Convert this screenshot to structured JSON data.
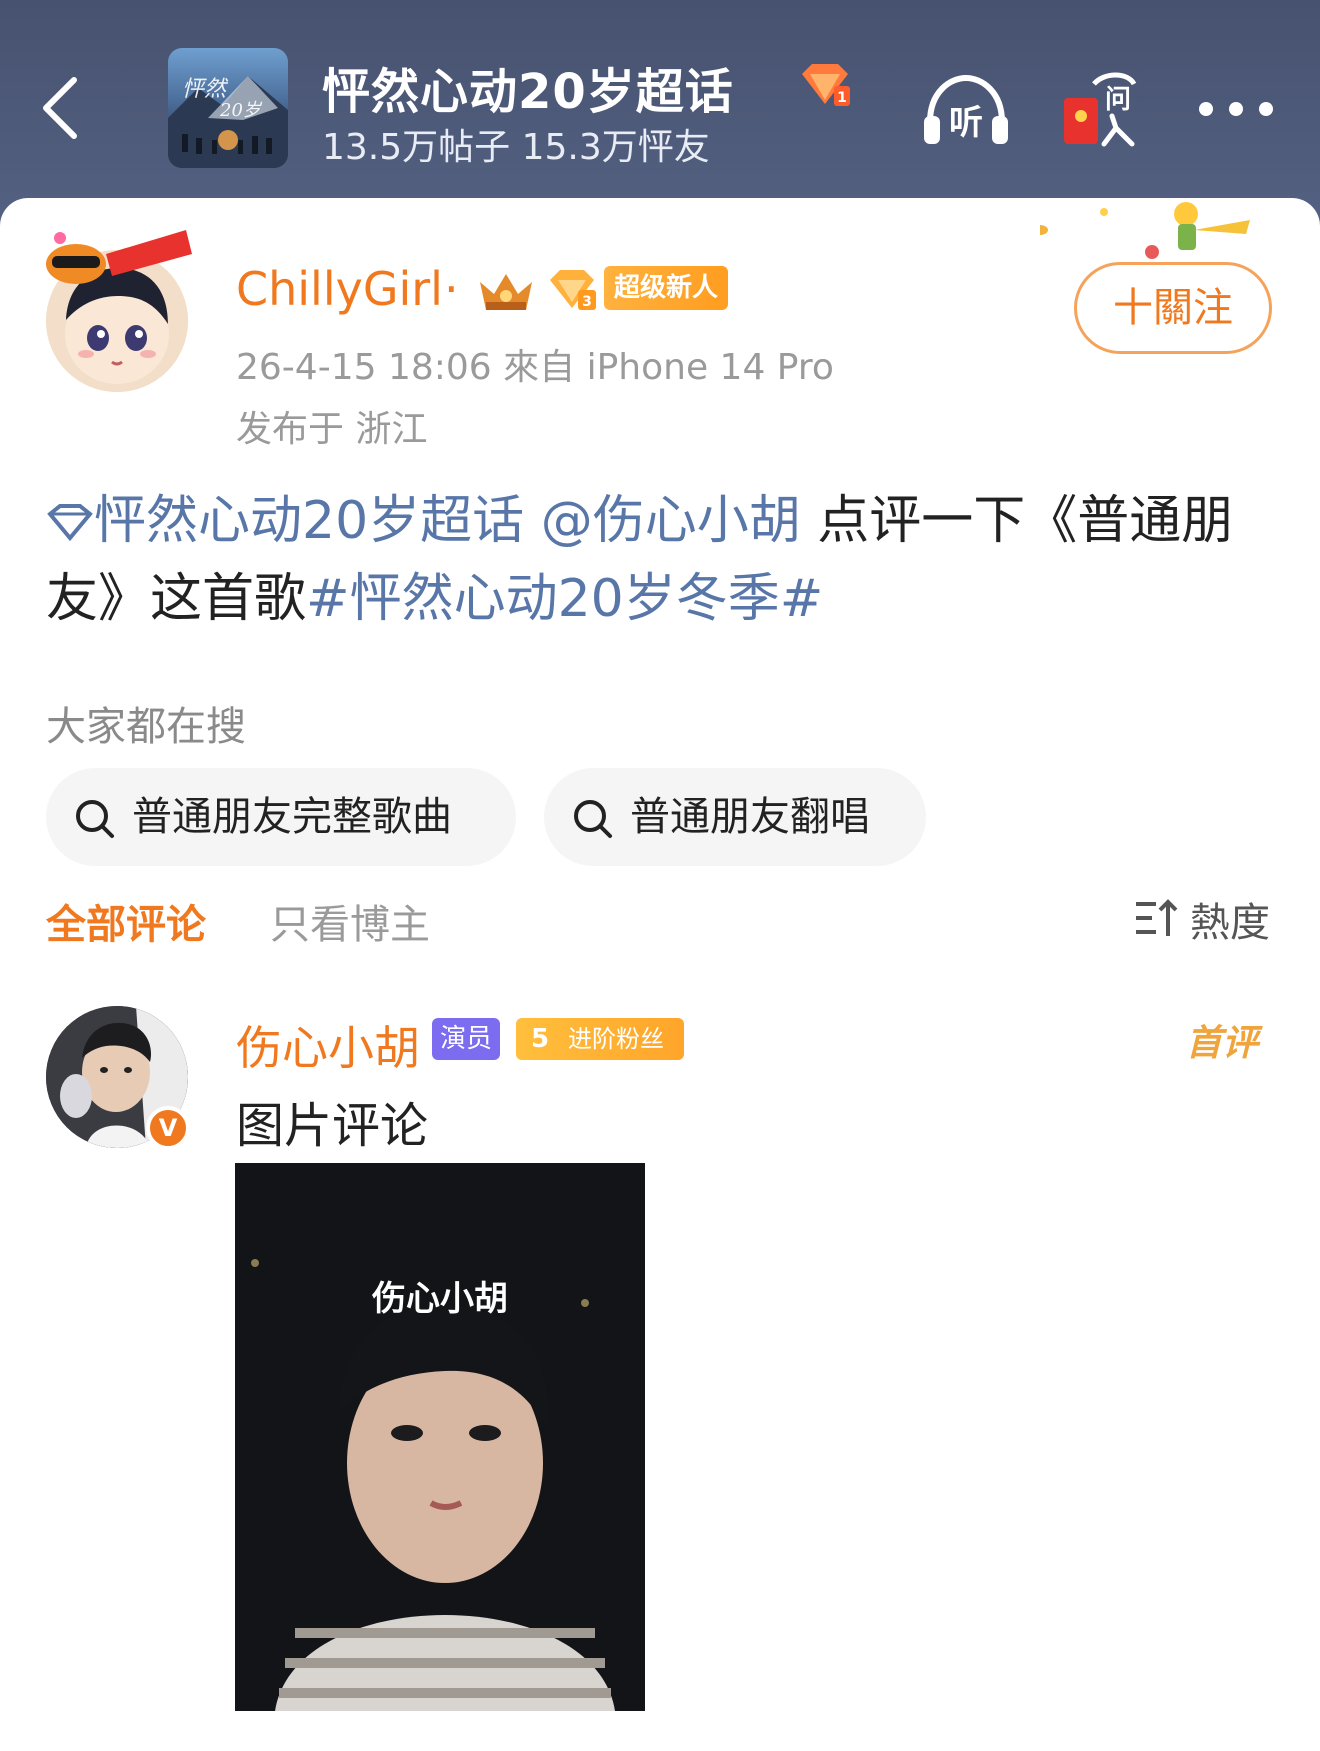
{
  "header": {
    "topic_title": "怦然心动20岁超话",
    "topic_stats": "13.5万帖子 15.3万怦友",
    "listen_label": "听",
    "ask_label": "问"
  },
  "post": {
    "username": "ChillyGirl",
    "username_dot": "·",
    "badge_label": "超级新人",
    "meta": "26-4-15 18:06   來自 iPhone 14 Pro",
    "location": "发布于 浙江",
    "follow_label": "十關注",
    "text": {
      "topic_link": "怦然心动20岁超话",
      "mention": "@伤心小胡",
      "body_1": " 点评一下《普通朋友》这首歌",
      "hashtag": "#怦然心动20岁冬季#"
    }
  },
  "search": {
    "title": "大家都在搜",
    "chips": [
      "普通朋友完整歌曲",
      "普通朋友翻唱"
    ]
  },
  "tabs": {
    "all": "全部评论",
    "author_only": "只看博主",
    "sort": "熱度"
  },
  "comment": {
    "username": "伤心小胡",
    "actor_badge": "演员",
    "fan_level": "5",
    "fan_badge": "进阶粉丝",
    "first_label": "首评",
    "text": "图片评论",
    "image_caption": "伤心小胡"
  }
}
